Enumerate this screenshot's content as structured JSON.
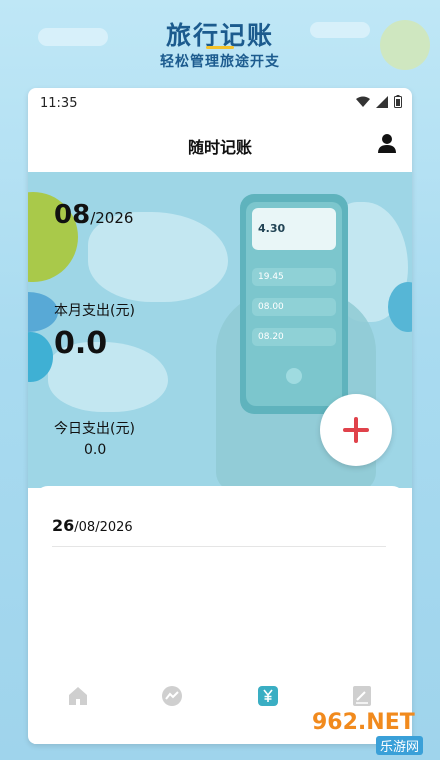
{
  "promo": {
    "title": "旅行记账",
    "subtitle": "轻松管理旅途开支"
  },
  "status": {
    "time": "11:35"
  },
  "app": {
    "title": "随时记账"
  },
  "summary": {
    "month": "08",
    "year_suffix": "/2026",
    "month_label": "本月支出(元)",
    "month_amount": "0.0",
    "today_label": "今日支出(元)",
    "today_amount": "0.0"
  },
  "illustration": {
    "rows": [
      "19.45",
      "08.00",
      "08.20"
    ],
    "card_time": "4.30"
  },
  "day": {
    "day": "26",
    "rest": "/08/2026"
  },
  "nav": {
    "items": [
      {
        "icon": "home-icon",
        "active": false
      },
      {
        "icon": "chart-icon",
        "active": false
      },
      {
        "icon": "yuan-icon",
        "active": true
      },
      {
        "icon": "note-icon",
        "active": false
      }
    ],
    "active_color": "#3aaec3",
    "inactive_color": "#cfcfcf"
  },
  "watermark": {
    "brand": "962.NET",
    "sub": "乐游网"
  },
  "colors": {
    "accent": "#e0424b",
    "brand": "#1c5b8e",
    "banner": "#9ed6e6"
  }
}
